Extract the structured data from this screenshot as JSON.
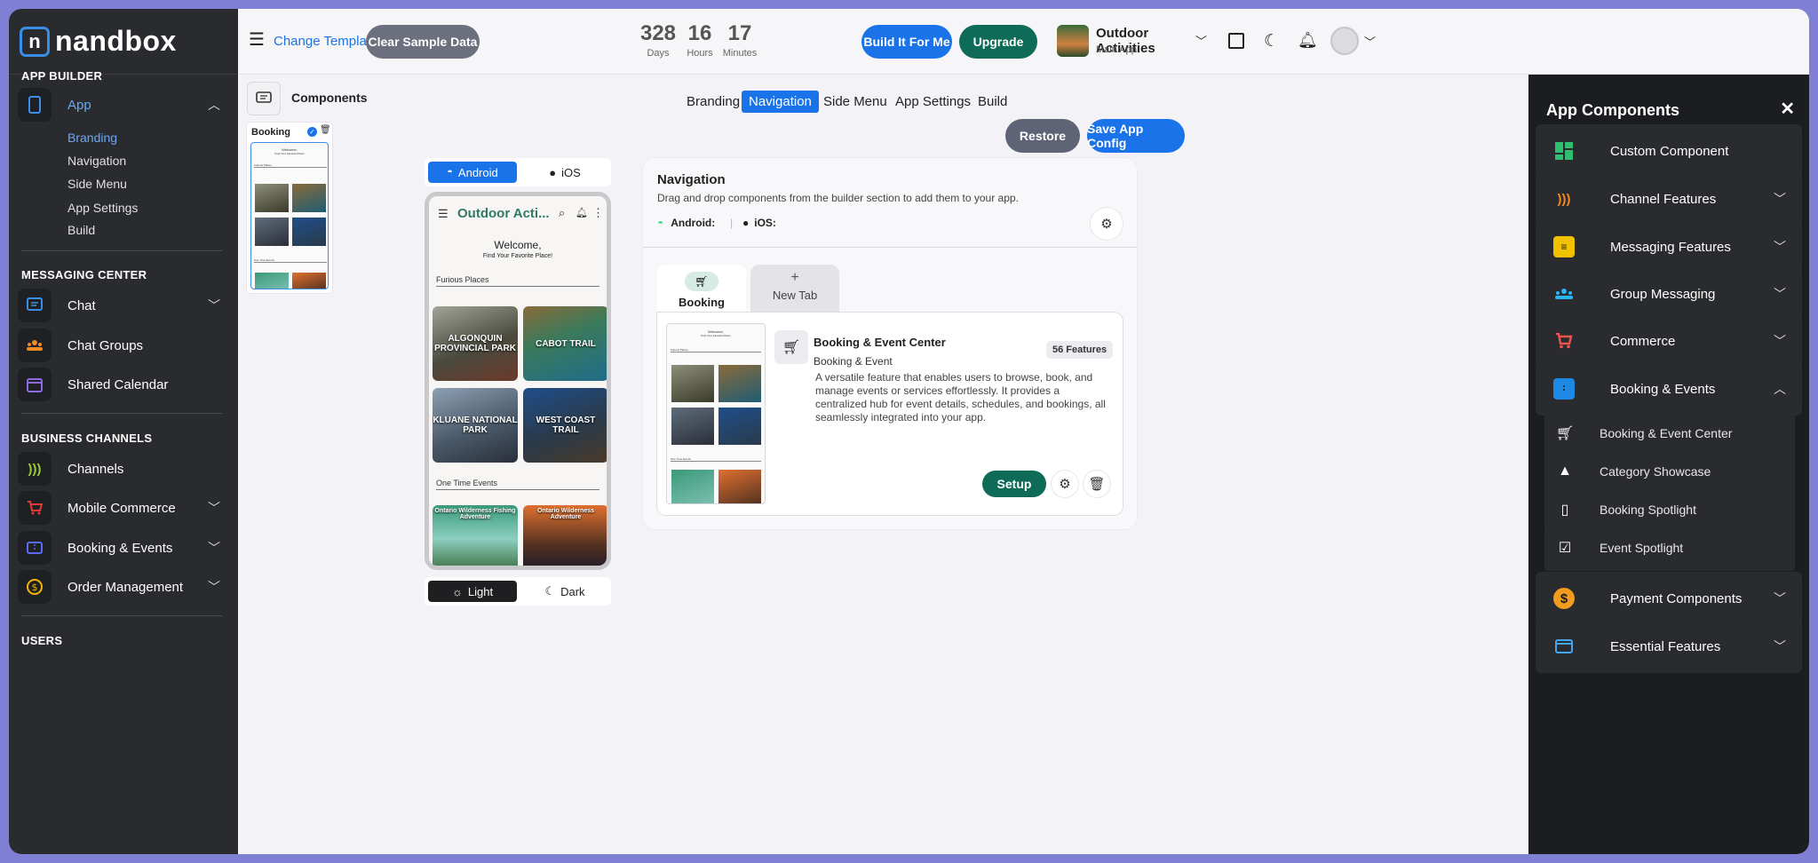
{
  "brand": {
    "logo_text": "nandbox"
  },
  "sidebar": {
    "app_builder_title": "APP BUILDER",
    "app_item": "App",
    "sub_items": [
      "Branding",
      "Navigation",
      "Side Menu",
      "App Settings",
      "Build"
    ],
    "messaging_title": "MESSAGING CENTER",
    "messaging_items": [
      "Chat",
      "Chat Groups",
      "Shared Calendar"
    ],
    "business_title": "BUSINESS CHANNELS",
    "business_items": [
      "Channels",
      "Mobile Commerce",
      "Booking & Events",
      "Order Management"
    ],
    "users_title": "USERS"
  },
  "topbar": {
    "change_template": "Change Template",
    "clear_sample": "Clear Sample Data",
    "days_num": "328",
    "days_lbl": "Days",
    "hours_num": "16",
    "hours_lbl": "Hours",
    "minutes_num": "17",
    "minutes_lbl": "Minutes",
    "build_for_me": "Build It For Me",
    "upgrade": "Upgrade",
    "app_name": "Outdoor Activities",
    "app_sub": "Main App"
  },
  "builder": {
    "components_label": "Components",
    "tabs": [
      "Branding",
      "Navigation",
      "Side Menu",
      "App Settings",
      "Build"
    ],
    "active_tab": "Navigation",
    "restore": "Restore",
    "save_config": "Save App Config",
    "mini_card_title": "Booking",
    "mini_welcome": "Welcome,",
    "mini_find": "Find Your Favorite Place!",
    "mini_section1": "Furious Places",
    "mini_section2": "One Time Events"
  },
  "preview": {
    "android": "Android",
    "ios": "iOS",
    "app_title": "Outdoor Acti...",
    "welcome": "Welcome,",
    "subtitle": "Find Your Favorite Place!",
    "section1": "Furious Places",
    "places": [
      "ALGONQUIN PROVINCIAL PARK",
      "CABOT TRAIL",
      "KLUANE NATIONAL PARK",
      "WEST COAST TRAIL"
    ],
    "section2": "One Time Events",
    "events": [
      "Ontario Wilderness Fishing Adventure",
      "Ontario Wilderness Adventure"
    ],
    "light": "Light",
    "dark": "Dark"
  },
  "navigation": {
    "title": "Navigation",
    "desc": "Drag and drop components from the builder section to add them to your app.",
    "android": "Android:",
    "ios": "iOS:",
    "tab_booking": "Booking",
    "tab_new": "New Tab",
    "feature_title": "Booking & Event Center",
    "feature_count": "56 Features",
    "feature_sub": "Booking & Event",
    "feature_desc": "A versatile feature that enables users to browse, book, and manage events or services effortlessly. It provides a centralized hub for event details, schedules, and bookings, all seamlessly integrated into your app.",
    "setup": "Setup"
  },
  "right_panel": {
    "title": "App Components",
    "items": [
      "Custom Component",
      "Channel Features",
      "Messaging Features",
      "Group Messaging",
      "Commerce",
      "Booking & Events"
    ],
    "sub_items": [
      "Booking & Event Center",
      "Category Showcase",
      "Booking Spotlight",
      "Event Spotlight"
    ],
    "bottom_items": [
      "Payment Components",
      "Essential Features"
    ]
  },
  "colors": {
    "primary": "#1a73e8",
    "green": "#0d6b57",
    "sidebar": "#2a2b2e",
    "panel": "#1c1d20"
  }
}
